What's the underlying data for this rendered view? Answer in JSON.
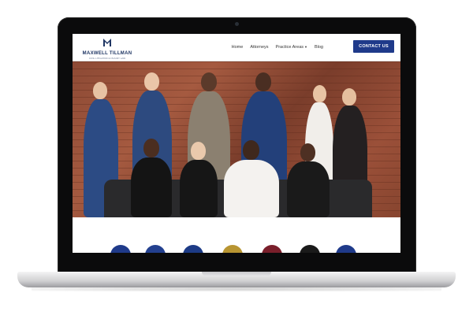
{
  "site": {
    "logo": {
      "name": "MAXWELL TILLMAN",
      "tagline": "CIVIL LITIGATION & INJURY LAW"
    },
    "nav": {
      "items": [
        {
          "label": "Home"
        },
        {
          "label": "Attorneys"
        },
        {
          "label": "Practice Areas",
          "has_dropdown": true
        },
        {
          "label": "Blog"
        }
      ],
      "cta_label": "CONTACT US"
    },
    "hero": {
      "image": "team-photo-brick-wall"
    },
    "badges": [
      {
        "name": "award-badge",
        "color": "#1f3a8a"
      },
      {
        "name": "award-badge",
        "color": "#23408f"
      },
      {
        "name": "award-badge",
        "color": "#1d3b86"
      },
      {
        "name": "award-badge",
        "color": "#b89532"
      },
      {
        "name": "award-badge",
        "color": "#7a1f2b"
      },
      {
        "name": "award-badge",
        "color": "#1a1a1a"
      },
      {
        "name": "award-badge",
        "color": "#1f3a8a"
      }
    ]
  },
  "colors": {
    "brand": "#1f3a8a",
    "laptop_bezel": "#0b0b0c"
  }
}
